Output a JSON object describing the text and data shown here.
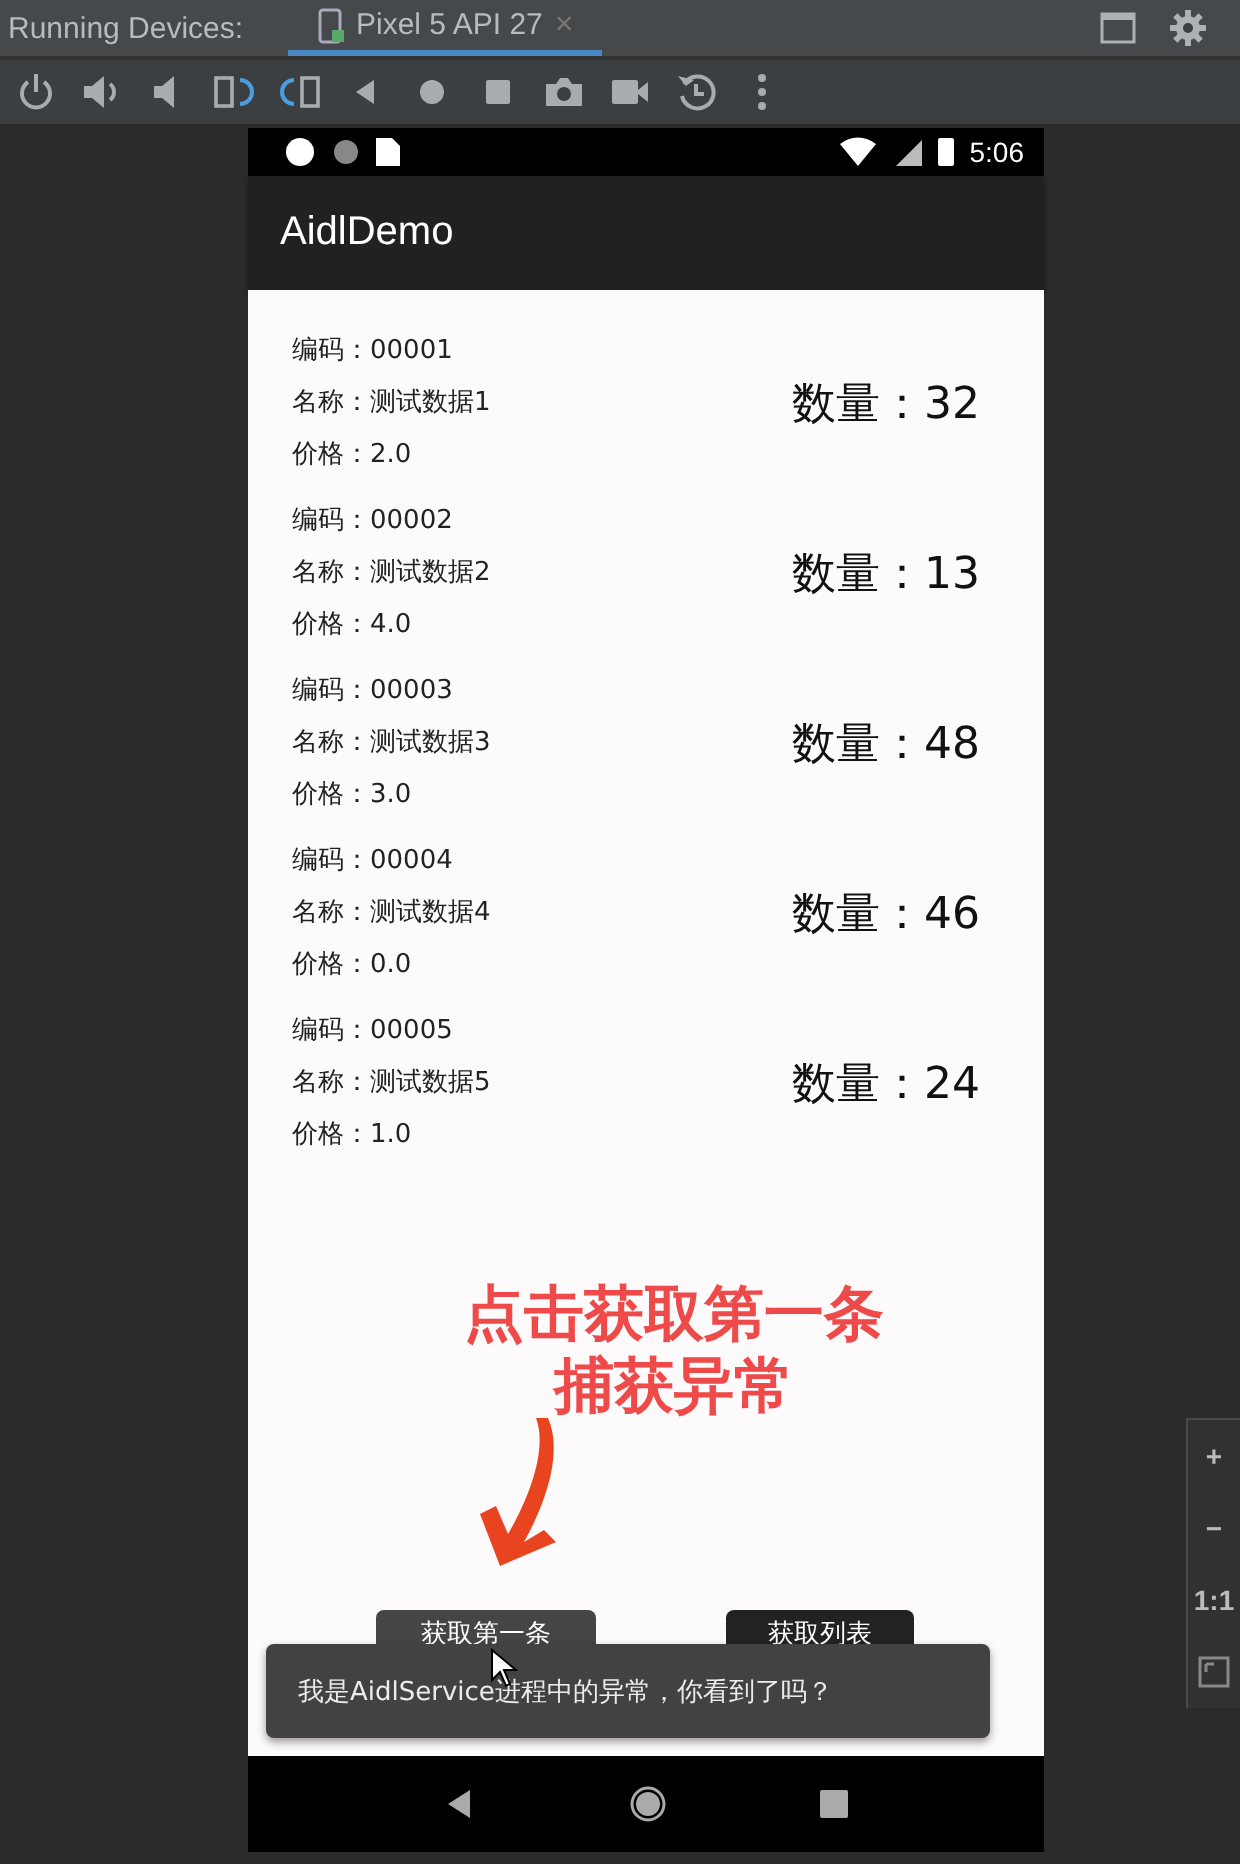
{
  "ide": {
    "label": "Running Devices:",
    "tabs": [
      {
        "label": "Pixel 5 API 27",
        "selected": true,
        "close": "×"
      }
    ]
  },
  "toolbar": [
    {
      "kind": "power"
    },
    {
      "kind": "volume-up"
    },
    {
      "kind": "volume-down"
    },
    {
      "kind": "rotate-left"
    },
    {
      "kind": "rotate-right"
    },
    {
      "kind": "back"
    },
    {
      "kind": "home"
    },
    {
      "kind": "overview"
    },
    {
      "kind": "camera"
    },
    {
      "kind": "video"
    },
    {
      "kind": "snapshot"
    },
    {
      "kind": "more"
    }
  ],
  "device": {
    "status_bar": {
      "time": "5:06"
    },
    "app_bar": {
      "title": "AidlDemo"
    },
    "items": [
      {
        "code": "编码：00001",
        "name": "名称：测试数据1",
        "price": "价格：2.0",
        "quantity": "数量：32"
      },
      {
        "code": "编码：00002",
        "name": "名称：测试数据2",
        "price": "价格：4.0",
        "quantity": "数量：13"
      },
      {
        "code": "编码：00003",
        "name": "名称：测试数据3",
        "price": "价格：3.0",
        "quantity": "数量：48"
      },
      {
        "code": "编码：00004",
        "name": "名称：测试数据4",
        "price": "价格：0.0",
        "quantity": "数量：46"
      },
      {
        "code": "编码：00005",
        "name": "名称：测试数据5",
        "price": "价格：1.0",
        "quantity": "数量：24"
      }
    ],
    "buttons": [
      {
        "label": "获取第一条",
        "pressed": true
      },
      {
        "label": "获取列表",
        "pressed": false
      }
    ],
    "toast": {
      "text": "我是AidlService进程中的异常，你看到了吗？"
    }
  },
  "annotation": {
    "lines": [
      "点击获取第一条",
      "捕获异常"
    ]
  },
  "zoom_controls": [
    {
      "kind": "text",
      "label": "+"
    },
    {
      "kind": "text",
      "label": "−"
    },
    {
      "kind": "text",
      "label": "1:1"
    },
    {
      "kind": "fit"
    }
  ]
}
